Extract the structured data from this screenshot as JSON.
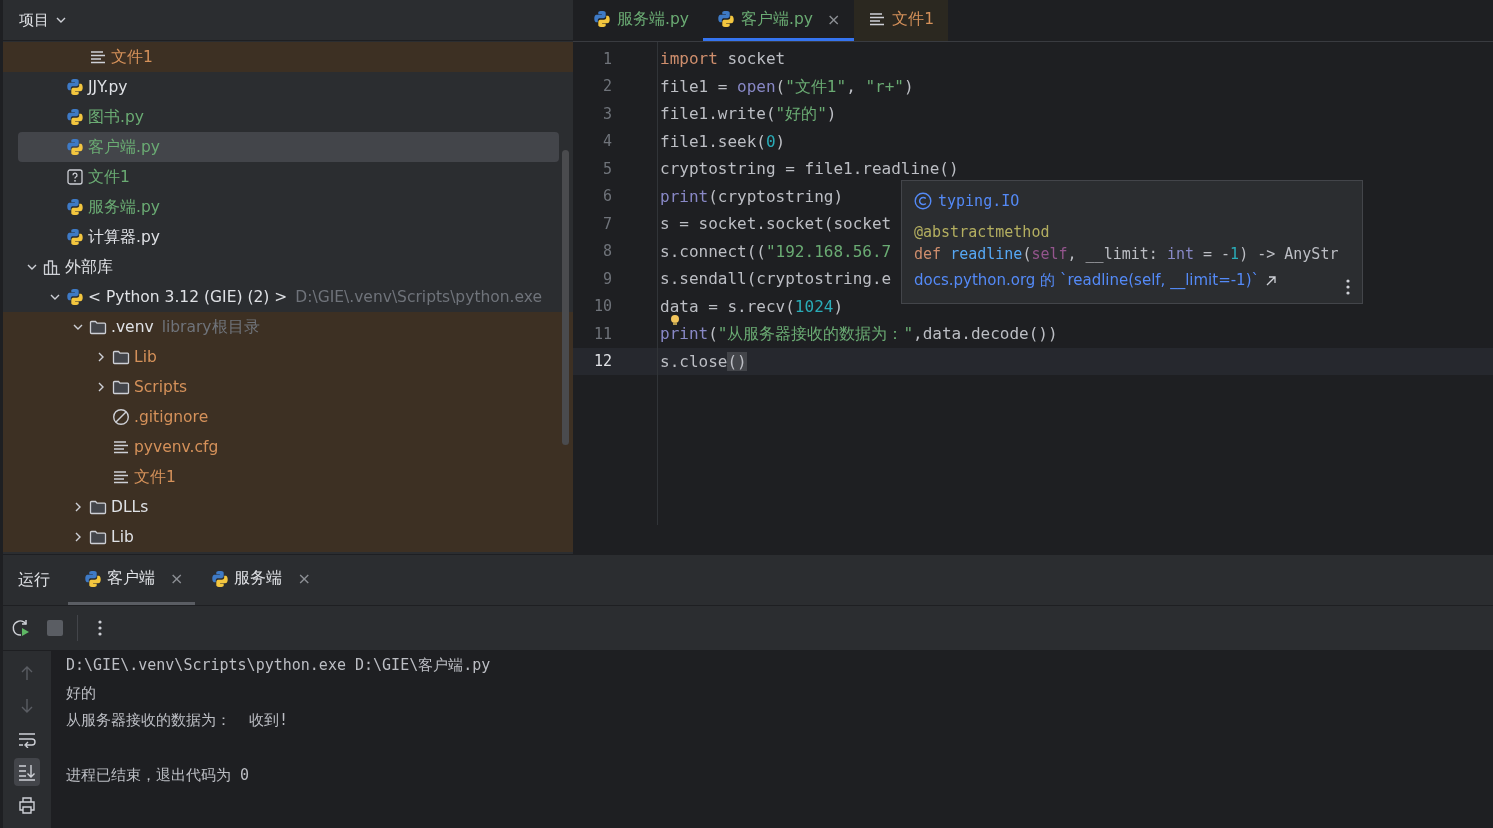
{
  "project_panel": {
    "title": "项目",
    "tree": [
      {
        "children": [
          {
            "children": [
              {
                "label": "文件1",
                "kind": "text",
                "color": "#d5915a",
                "ignored": true,
                "selected": false
              }
            ]
          },
          {
            "label": "JJY.py",
            "kind": "python",
            "color": "#dfe1e5",
            "ignored": false,
            "selected": false
          },
          {
            "label": "图书.py",
            "kind": "python",
            "color": "#6aab73",
            "ignored": false,
            "selected": false
          },
          {
            "label": "客户端.py",
            "kind": "python",
            "color": "#6aab73",
            "ignored": false,
            "selected": true
          },
          {
            "label": "文件1",
            "kind": "unknown",
            "color": "#6aab73",
            "ignored": false,
            "selected": false
          },
          {
            "label": "服务端.py",
            "kind": "python",
            "color": "#6aab73",
            "ignored": false,
            "selected": false
          },
          {
            "label": "计算器.py",
            "kind": "python",
            "color": "#dfe1e5",
            "ignored": false,
            "selected": false
          }
        ]
      },
      {
        "label": "外部库",
        "kind": "library",
        "color": "#dfe1e5",
        "ignored": false,
        "selected": false,
        "expanded": true,
        "children": [
          {
            "label": "< Python 3.12 (GIE) (2) >",
            "suffix": "D:\\GIE\\.venv\\Scripts\\python.exe",
            "kind": "python",
            "color": "#dfe1e5",
            "ignored": false,
            "selected": false,
            "expanded": true,
            "children": [
              {
                "label": ".venv",
                "suffix": "library根目录",
                "kind": "folder",
                "color": "#dfe1e5",
                "ignored": true,
                "selected": false,
                "expanded": true,
                "children": [
                  {
                    "label": "Lib",
                    "kind": "folder",
                    "color": "#d5915a",
                    "ignored": true,
                    "selected": false,
                    "expanded": false
                  },
                  {
                    "label": "Scripts",
                    "kind": "folder",
                    "color": "#d5915a",
                    "ignored": true,
                    "selected": false,
                    "expanded": false
                  },
                  {
                    "label": ".gitignore",
                    "kind": "ignore",
                    "color": "#d5915a",
                    "ignored": true,
                    "selected": false
                  },
                  {
                    "label": "pyvenv.cfg",
                    "kind": "text",
                    "color": "#d5915a",
                    "ignored": true,
                    "selected": false
                  },
                  {
                    "label": "文件1",
                    "kind": "text",
                    "color": "#d5915a",
                    "ignored": true,
                    "selected": false
                  }
                ]
              },
              {
                "label": "DLLs",
                "kind": "folder",
                "color": "#dfe1e5",
                "ignored": true,
                "selected": false,
                "expanded": false
              },
              {
                "label": "Lib",
                "kind": "folder",
                "color": "#dfe1e5",
                "ignored": true,
                "selected": false,
                "expanded": false
              }
            ]
          }
        ]
      }
    ]
  },
  "editor": {
    "tabs": [
      {
        "label": "服务端.py",
        "kind": "python",
        "color": "#6aab73",
        "ignored": false,
        "selected": false
      },
      {
        "label": "客户端.py",
        "kind": "python",
        "color": "#6aab73",
        "ignored": false,
        "selected": true,
        "close": "×"
      },
      {
        "label": "文件1",
        "kind": "text",
        "color": "#d5915a",
        "ignored": true,
        "selected": false
      }
    ],
    "lines": [
      {
        "number": "1",
        "current": false,
        "tokens": [
          {
            "kind": "kw",
            "text": "import"
          },
          {
            "kind": "plain",
            "text": " socket"
          }
        ]
      },
      {
        "number": "2",
        "current": false,
        "tokens": [
          {
            "kind": "plain",
            "text": "file1 = "
          },
          {
            "kind": "builtin",
            "text": "open"
          },
          {
            "kind": "plain",
            "text": "("
          },
          {
            "kind": "str",
            "text": "\"文件1\""
          },
          {
            "kind": "plain",
            "text": ", "
          },
          {
            "kind": "str",
            "text": "\"r+\""
          },
          {
            "kind": "plain",
            "text": ")"
          }
        ]
      },
      {
        "number": "3",
        "current": false,
        "tokens": [
          {
            "kind": "plain",
            "text": "file1.write("
          },
          {
            "kind": "str",
            "text": "\"好的\""
          },
          {
            "kind": "plain",
            "text": ")"
          }
        ]
      },
      {
        "number": "4",
        "current": false,
        "tokens": [
          {
            "kind": "plain",
            "text": "file1.seek("
          },
          {
            "kind": "num",
            "text": "0"
          },
          {
            "kind": "plain",
            "text": ")"
          }
        ]
      },
      {
        "number": "5",
        "current": false,
        "tokens": [
          {
            "kind": "plain",
            "text": "cryptostring = file1.readline()"
          }
        ]
      },
      {
        "number": "6",
        "current": false,
        "tokens": [
          {
            "kind": "builtin",
            "text": "print"
          },
          {
            "kind": "plain",
            "text": "(cryptostring)"
          }
        ]
      },
      {
        "number": "7",
        "current": false,
        "tokens": [
          {
            "kind": "plain",
            "text": "s = socket.socket(socket"
          }
        ]
      },
      {
        "number": "8",
        "current": false,
        "tokens": [
          {
            "kind": "plain",
            "text": "s.connect(("
          },
          {
            "kind": "str",
            "text": "\"192.168.56.7"
          }
        ]
      },
      {
        "number": "9",
        "current": false,
        "tokens": [
          {
            "kind": "plain",
            "text": "s.sendall(cryptostring.e"
          }
        ]
      },
      {
        "number": "10",
        "current": false,
        "tokens": [
          {
            "kind": "plain",
            "text": "data = s.recv("
          },
          {
            "kind": "num",
            "text": "1024"
          },
          {
            "kind": "plain",
            "text": ")"
          }
        ]
      },
      {
        "number": "11",
        "current": false,
        "bulb": true,
        "tokens": [
          {
            "kind": "builtin",
            "text": "print"
          },
          {
            "kind": "plain",
            "text": "("
          },
          {
            "kind": "str",
            "text": "\"从服务器接收的数据为：\""
          },
          {
            "kind": "plain",
            "text": ",data.decode())"
          }
        ]
      },
      {
        "number": "12",
        "current": true,
        "tokens": [
          {
            "kind": "plain",
            "text": "s.close"
          },
          {
            "kind": "match",
            "text": "()"
          }
        ]
      }
    ],
    "popup": {
      "class_name": "typing.IO",
      "decorator": "@abstractmethod",
      "signature": [
        {
          "kind": "kw",
          "text": "def "
        },
        {
          "kind": "fn",
          "text": "readline"
        },
        {
          "kind": "plain",
          "text": "("
        },
        {
          "kind": "self",
          "text": "self"
        },
        {
          "kind": "plain",
          "text": ", __limit: "
        },
        {
          "kind": "builtin",
          "text": "int"
        },
        {
          "kind": "plain",
          "text": " = -"
        },
        {
          "kind": "num",
          "text": "1"
        },
        {
          "kind": "plain",
          "text": ") -> AnyStr"
        }
      ],
      "doc_link": "docs.python.org 的 `readline(self, __limit=-1)`"
    }
  },
  "run_panel": {
    "title": "运行",
    "tabs": [
      {
        "label": "客户端",
        "selected": true,
        "close": "×"
      },
      {
        "label": "服务端",
        "selected": false,
        "close": "×"
      }
    ],
    "side_tools": [
      {
        "kind": "up",
        "disabled": true,
        "selected": false
      },
      {
        "kind": "down",
        "disabled": true,
        "selected": false
      },
      {
        "kind": "wrap",
        "disabled": false,
        "selected": false
      },
      {
        "kind": "scroll-end",
        "disabled": false,
        "selected": true
      },
      {
        "kind": "print",
        "disabled": false,
        "selected": false
      }
    ],
    "console": [
      {
        "kind": "output",
        "text": "D:\\GIE\\.venv\\Scripts\\python.exe D:\\GIE\\客户端.py"
      },
      {
        "kind": "output",
        "text": "好的"
      },
      {
        "kind": "output",
        "text": "从服务器接收的数据为：  收到!"
      },
      {
        "kind": "exit",
        "text": "进程已结束，退出代码为 0"
      }
    ]
  }
}
